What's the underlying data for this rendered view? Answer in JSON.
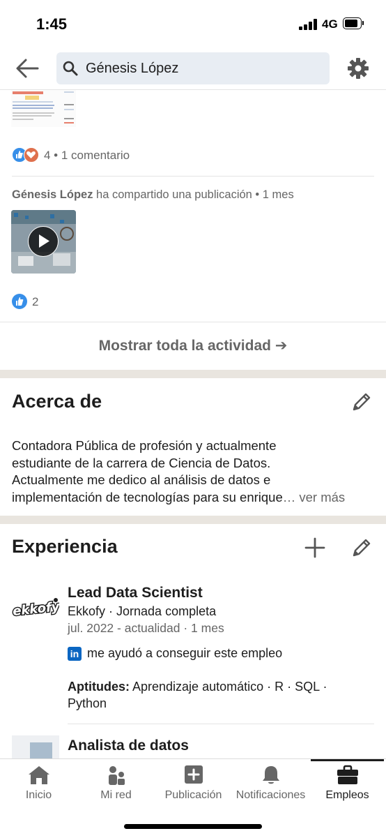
{
  "status_bar": {
    "time": "1:45",
    "network": "4G"
  },
  "search": {
    "query": "Génesis López"
  },
  "activity": {
    "post1_count": "4 • 1 comentario",
    "shared_author": "Génesis López",
    "shared_action": " ha compartido una publicación • 1 mes",
    "post2_count": "2",
    "show_all_label": "Mostrar toda la actividad ➔"
  },
  "about": {
    "title": "Acerca de",
    "lines": [
      "Contadora Pública de profesión y actualmente",
      "estudiante de la  carrera de Ciencia de Datos.",
      "Actualmente me dedico al análisis de datos e",
      "implementación de tecnologías para su enrique"
    ],
    "ellipsis": "…",
    "see_more": " ver más"
  },
  "experience": {
    "title": "Experiencia",
    "jobs": [
      {
        "logo_text": "ekkofy",
        "title": "Lead Data Scientist",
        "company": "Ekkofy · Jornada completa",
        "dates": "jul. 2022 - actualidad · 1 mes",
        "linkedin_badge": "in",
        "linkedin_note": "me ayudó a conseguir este empleo",
        "skills_label": "Aptitudes:",
        "skills": " Aprendizaje automático · R · SQL · Python"
      },
      {
        "title": "Analista de datos"
      }
    ]
  },
  "bottom_nav": {
    "items": [
      {
        "label": "Inicio",
        "icon": "home-icon"
      },
      {
        "label": "Mi red",
        "icon": "network-icon"
      },
      {
        "label": "Publicación",
        "icon": "post-icon"
      },
      {
        "label": "Notificaciones",
        "icon": "bell-icon"
      },
      {
        "label": "Empleos",
        "icon": "briefcase-icon"
      }
    ],
    "active": "Empleos"
  },
  "colors": {
    "linkedin_blue": "#0a66c2",
    "like_blue": "#378fe9",
    "love_orange": "#df704d",
    "search_bg": "#e8edf3",
    "section_gap": "#e9e5df"
  }
}
